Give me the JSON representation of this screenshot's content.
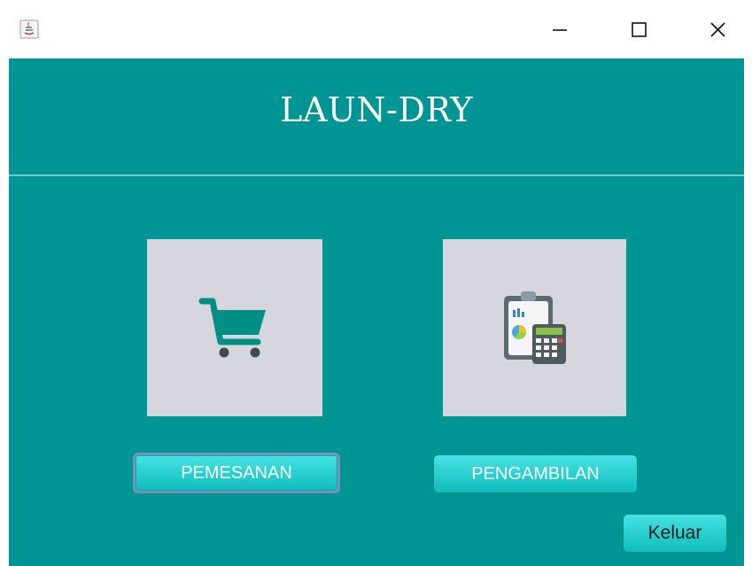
{
  "window": {
    "title": "LAUN-DRY"
  },
  "buttons": {
    "pemesanan": "PEMESANAN",
    "pengambilan": "PENGAMBILAN",
    "keluar": "Keluar"
  },
  "icons": {
    "app": "java-app-icon",
    "cart": "shopping-cart-icon",
    "report": "clipboard-calculator-icon",
    "minimize": "minimize-icon",
    "maximize": "maximize-icon",
    "close": "close-icon"
  },
  "colors": {
    "background": "#009595",
    "tile": "#d6d7de",
    "button": "#1fcaca",
    "cart": "#008f85"
  }
}
